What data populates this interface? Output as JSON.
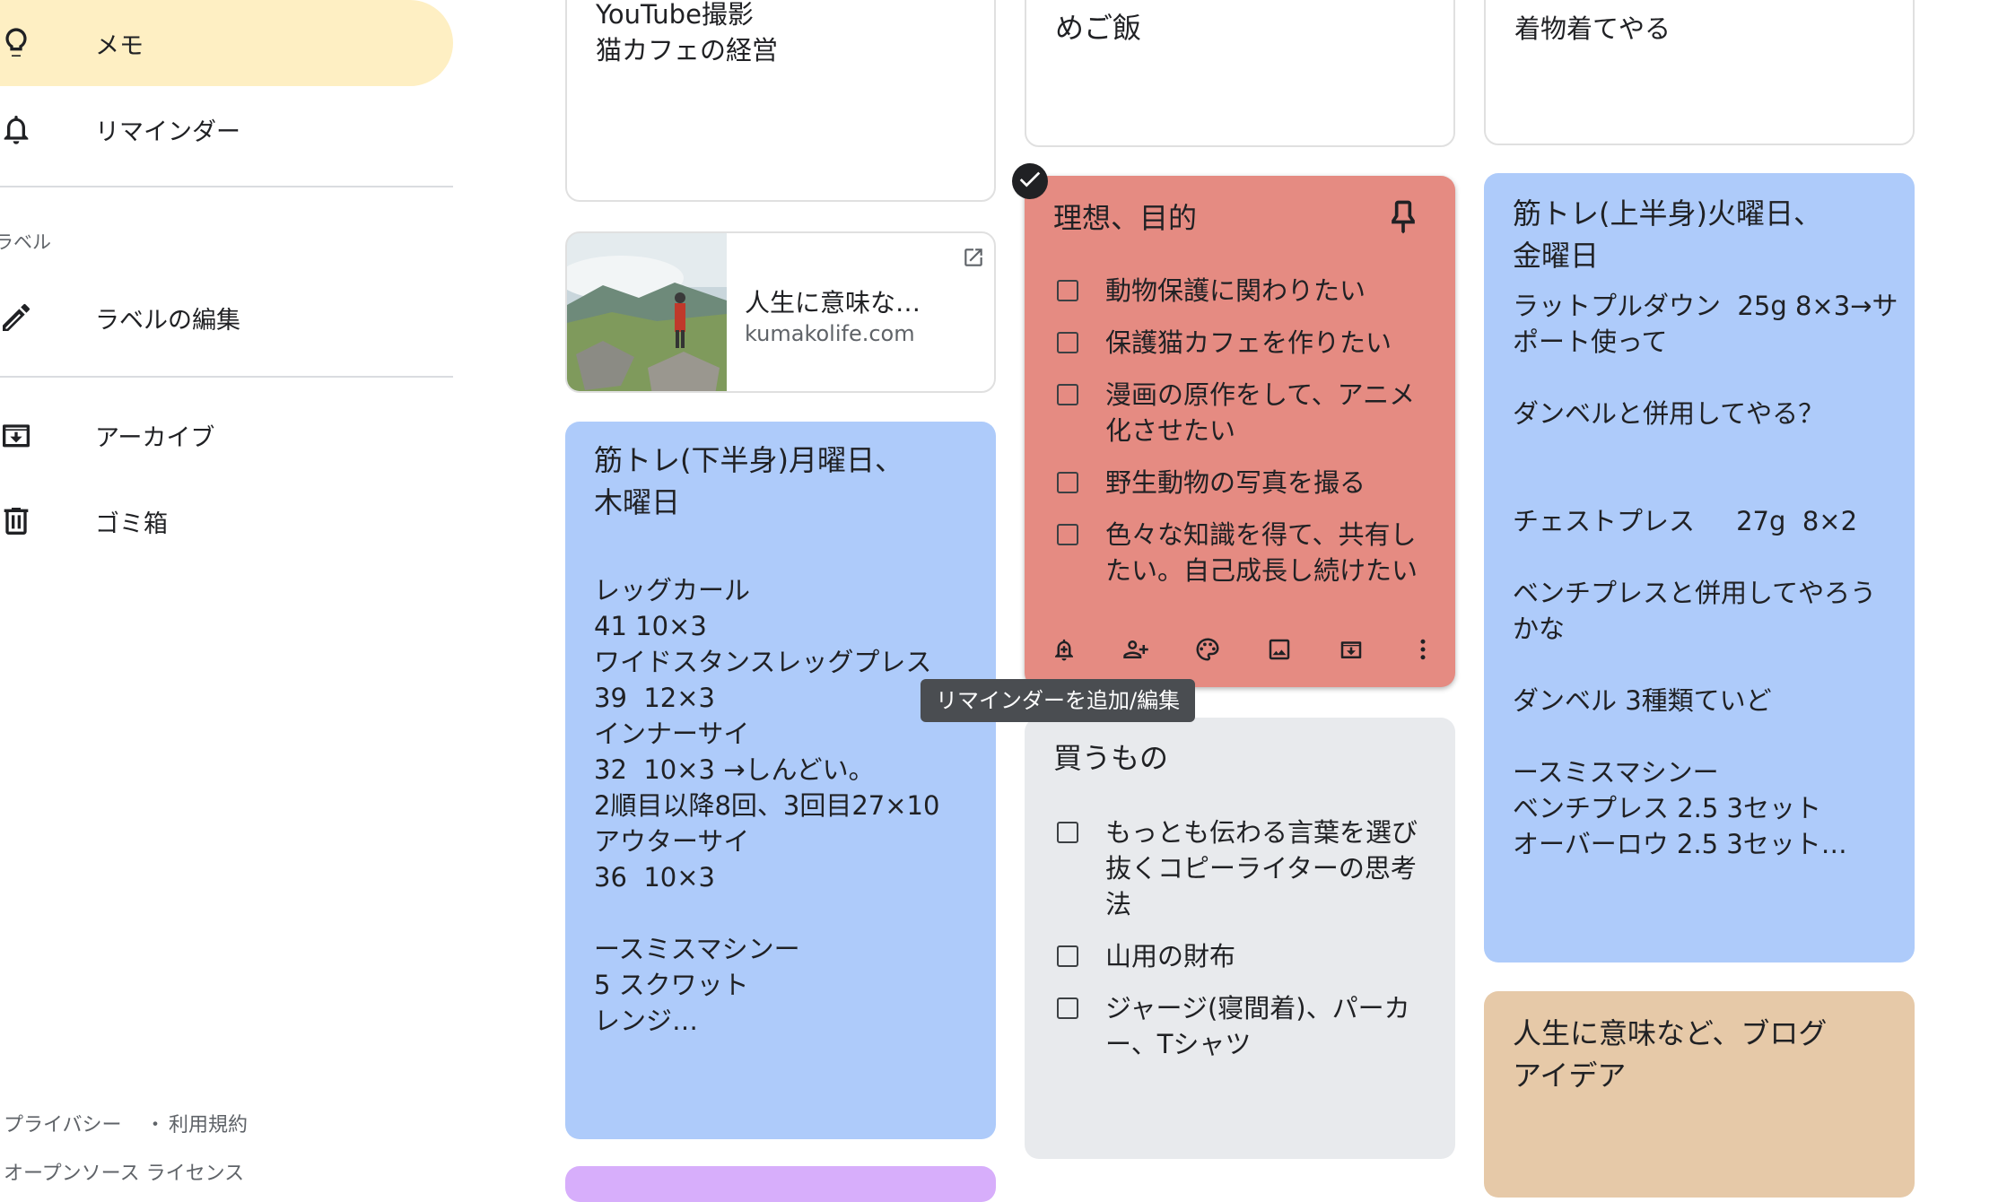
{
  "sidebar": {
    "items": [
      {
        "label": "メモ",
        "icon": "lightbulb-icon"
      },
      {
        "label": "リマインダー",
        "icon": "bell-icon"
      },
      {
        "label": "ラベルの編集",
        "icon": "pencil-icon"
      },
      {
        "label": "アーカイブ",
        "icon": "archive-icon"
      },
      {
        "label": "ゴミ箱",
        "icon": "trash-icon"
      }
    ],
    "section_label": "ラベル",
    "footer": {
      "privacy": "プライバシー",
      "separator": "・",
      "terms": "利用規約",
      "oss": "オープンソース ライセンス"
    }
  },
  "notes": {
    "youtube": {
      "line1": "YouTube撮影",
      "line2": "猫カフェの経営"
    },
    "meals": {
      "text": "めご飯"
    },
    "kimono": {
      "text": "着物着てやる"
    },
    "link": {
      "title": "人生に意味な…",
      "domain": "kumakolife.com"
    },
    "legs": {
      "title": "筋トレ(下半身)月曜日、\n木曜日",
      "body": "レッグカール\n41 10×3\nワイドスタンスレッグプレス\n39  12×3\nインナーサイ\n32  10×3 →しんどい。\n2順目以降8回、3回目27×10\nアウターサイ\n36  10×3\n\nースミスマシンー\n5 スクワット\nレンジ…"
    },
    "ideals": {
      "title": "理想、目的",
      "items": [
        "動物保護に関わりたい",
        "保護猫カフェを作りたい",
        "漫画の原作をして、アニメ\n化させたい",
        "野生動物の写真を撮る",
        "色々な知識を得て、共有し\nたい。自己成長し続けたい"
      ]
    },
    "shopping": {
      "title": "買うもの",
      "items": [
        "もっとも伝わる言葉を選び\n抜くコピーライターの思考\n法",
        "山用の財布",
        "ジャージ(寝間着)、パーカ\nー、Tシャツ"
      ]
    },
    "upper": {
      "title": "筋トレ(上半身)火曜日、\n金曜日",
      "body": "ラットプルダウン  25g 8×3→サ\nポート使って\n\nダンベルと併用してやる？\n\n\nチェストプレス     27g  8×2\n\nベンチプレスと併用してやろう\nかな\n\nダンベル 3種類ていど\n\nースミスマシンー\nベンチプレス 2.5 3セット\nオーバーロウ 2.5 3セット…"
    },
    "blog": {
      "title": "人生に意味など、ブログ\nアイデア"
    }
  },
  "tooltip": "リマインダーを追加/編集",
  "toolbar_icons": [
    "add-reminder-icon",
    "collaborator-icon",
    "palette-icon",
    "image-icon",
    "archive-icon",
    "more-icon"
  ],
  "colors": {
    "active_nav": "#feefc3",
    "blue_note": "#aecbfa",
    "red_note": "#e58b82",
    "gray_note": "#e8eaed",
    "sand_note": "#e6c9a8"
  }
}
